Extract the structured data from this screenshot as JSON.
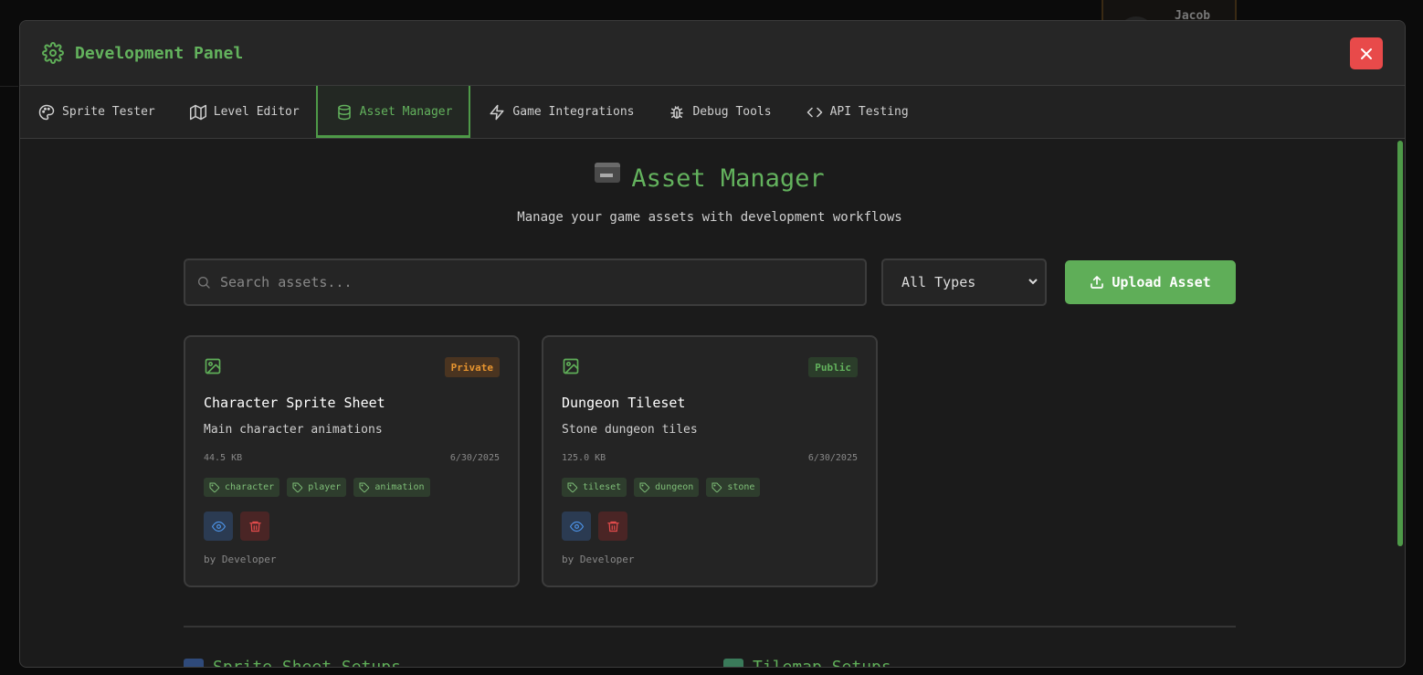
{
  "background": {
    "user_name": "Jacob"
  },
  "header": {
    "title": "Development Panel"
  },
  "tabs": [
    {
      "label": "Sprite Tester",
      "icon": "palette-icon"
    },
    {
      "label": "Level Editor",
      "icon": "map-icon"
    },
    {
      "label": "Asset Manager",
      "icon": "database-icon",
      "active": true
    },
    {
      "label": "Game Integrations",
      "icon": "zap-icon"
    },
    {
      "label": "Debug Tools",
      "icon": "bug-icon"
    },
    {
      "label": "API Testing",
      "icon": "code-icon"
    }
  ],
  "asset_manager": {
    "title": "Asset Manager",
    "subtitle": "Manage your game assets with development workflows",
    "search_placeholder": "Search assets...",
    "type_filter": "All Types",
    "upload_label": "Upload Asset"
  },
  "assets": [
    {
      "name": "Character Sprite Sheet",
      "description": "Main character animations",
      "visibility": "Private",
      "size": "44.5 KB",
      "date": "6/30/2025",
      "tags": [
        "character",
        "player",
        "animation"
      ],
      "author": "by Developer"
    },
    {
      "name": "Dungeon Tileset",
      "description": "Stone dungeon tiles",
      "visibility": "Public",
      "size": "125.0 KB",
      "date": "6/30/2025",
      "tags": [
        "tileset",
        "dungeon",
        "stone"
      ],
      "author": "by Developer"
    }
  ],
  "sections": {
    "sprite_sheet": "Sprite Sheet Setups",
    "tilemap": "Tilemap Setups"
  },
  "colors": {
    "accent": "#5fae58",
    "close": "#e84a4a",
    "private": "#e8952f",
    "view": "#4b8fe0",
    "delete": "#e14b4b"
  }
}
